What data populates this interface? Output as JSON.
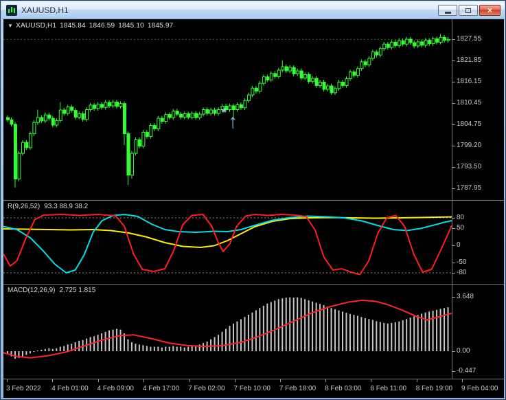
{
  "window": {
    "title": "XAUUSD,H1",
    "controls": {
      "minimize": "minimize",
      "restore": "restore",
      "close_glyph": "×"
    }
  },
  "chart": {
    "info": {
      "marker": "▼",
      "symbol": "XAUUSD,H1",
      "open": "1845.84",
      "high": "1846.59",
      "low": "1845.10",
      "close": "1845.97"
    },
    "price_axis_labels": [
      "1827.55",
      "1821.85",
      "1816.15",
      "1810.45",
      "1804.75",
      "1799.20",
      "1793.50",
      "1787.95"
    ],
    "time_axis_labels": [
      "3 Feb 2022",
      "4 Feb 01:00",
      "4 Feb 09:00",
      "4 Feb 17:00",
      "7 Feb 02:00",
      "7 Feb 10:00",
      "7 Feb 18:00",
      "8 Feb 03:00",
      "8 Feb 11:00",
      "8 Feb 19:00",
      "9 Feb 04:00"
    ],
    "colors": {
      "bull_fill": "#000000",
      "bear_fill": "#33ff33",
      "candle_outline": "#33ff33",
      "last_price_line": "#2f6e2f",
      "rci_short": "#ff1f1f",
      "rci_mid": "#00dde8",
      "rci_long": "#ffee00",
      "macd_hist": "#c8c8c8",
      "macd_signal": "#ff2424",
      "annotation": "#7fabd8"
    }
  },
  "indicators": [
    {
      "name": "R(9,26,52)",
      "values": "93.3 88.9 38.2",
      "scale_labels": [
        "80",
        "50",
        "0",
        "-50",
        "-80"
      ],
      "scale_values": [
        80,
        50,
        0,
        -50,
        -80
      ]
    },
    {
      "name": "MACD(12,26,9)",
      "values": "2.725 1.815",
      "scale_labels": [
        "3.648",
        "0.00",
        "-0.447"
      ],
      "scale_values": [
        3.648,
        0,
        -0.447
      ]
    }
  ],
  "chart_data": [
    {
      "type": "candlestick",
      "title": "XAUUSD,H1",
      "timeframe": "H1",
      "price_range_visible": [
        1784.9,
        1832.9
      ],
      "last_price": 1827.55,
      "first_open": 1806.8,
      "default_wick": 0.6,
      "closes": [
        1806.2,
        1805.0,
        1790.5,
        1797.3,
        1800.2,
        1798.8,
        1802.5,
        1805.5,
        1806.8,
        1805.9,
        1807.5,
        1806.6,
        1804.8,
        1806.0,
        1808.8,
        1807.9,
        1809.6,
        1808.7,
        1806.9,
        1807.8,
        1806.3,
        1808.9,
        1810.1,
        1809.2,
        1810.3,
        1809.5,
        1810.8,
        1809.9,
        1810.9,
        1809.8,
        1810.5,
        1802.5,
        1791.5,
        1797.3,
        1800.9,
        1799.2,
        1802.9,
        1801.8,
        1804.7,
        1803.8,
        1806.6,
        1805.8,
        1807.6,
        1806.8,
        1808.5,
        1807.7,
        1806.9,
        1807.8,
        1806.9,
        1807.9,
        1806.8,
        1807.7,
        1808.9,
        1807.9,
        1808.8,
        1807.9,
        1808.9,
        1809.8,
        1808.9,
        1809.9,
        1808.9,
        1810.2,
        1809.4,
        1811.3,
        1812.8,
        1814.6,
        1813.8,
        1815.9,
        1817.6,
        1816.8,
        1818.5,
        1817.7,
        1819.4,
        1820.3,
        1819.2,
        1820.1,
        1818.4,
        1819.2,
        1817.3,
        1818.2,
        1816.4,
        1817.2,
        1815.3,
        1816.2,
        1814.3,
        1815.2,
        1813.4,
        1814.5,
        1816.2,
        1815.3,
        1817.1,
        1818.9,
        1818.0,
        1819.8,
        1821.6,
        1820.8,
        1822.5,
        1824.2,
        1823.4,
        1825.1,
        1826.3,
        1825.4,
        1826.8,
        1825.9,
        1827.2,
        1826.3,
        1827.6,
        1826.7,
        1825.8,
        1826.9,
        1826.0,
        1827.3,
        1826.4,
        1827.7,
        1826.8,
        1828.1,
        1827.3,
        1827.55
      ],
      "wick_overrides": {
        "2": {
          "low": 1788.2
        },
        "3": {
          "low": 1789.8
        },
        "8": {
          "high": 1808.9
        },
        "14": {
          "high": 1810.9
        },
        "31": {
          "low": 1799.5
        },
        "32": {
          "low": 1788.9
        },
        "33": {
          "low": 1790.6
        },
        "60": {
          "low": 1806.2
        },
        "73": {
          "high": 1822.0
        },
        "115": {
          "high": 1829.0
        }
      }
    },
    {
      "type": "line",
      "title": "R(9,26,52)",
      "current_values": "93.3 88.9 38.2",
      "ylim": [
        -100,
        100
      ],
      "yticks": [
        80,
        50,
        0,
        -50,
        -80
      ],
      "levels": [
        80,
        -80
      ],
      "series": [
        {
          "name": "RCI-9",
          "color": "#ff1f1f",
          "points": [
            [
              0,
              -25
            ],
            [
              0.015,
              -60
            ],
            [
              0.03,
              -45
            ],
            [
              0.05,
              20
            ],
            [
              0.07,
              75
            ],
            [
              0.09,
              88
            ],
            [
              0.13,
              90
            ],
            [
              0.17,
              87
            ],
            [
              0.21,
              90
            ],
            [
              0.25,
              86
            ],
            [
              0.27,
              55
            ],
            [
              0.29,
              -25
            ],
            [
              0.31,
              -70
            ],
            [
              0.335,
              -76
            ],
            [
              0.36,
              -68
            ],
            [
              0.38,
              -15
            ],
            [
              0.4,
              60
            ],
            [
              0.42,
              87
            ],
            [
              0.445,
              90
            ],
            [
              0.465,
              55
            ],
            [
              0.478,
              12
            ],
            [
              0.49,
              -18
            ],
            [
              0.505,
              5
            ],
            [
              0.52,
              55
            ],
            [
              0.54,
              85
            ],
            [
              0.56,
              90
            ],
            [
              0.59,
              87
            ],
            [
              0.62,
              90
            ],
            [
              0.65,
              88
            ],
            [
              0.675,
              84
            ],
            [
              0.695,
              45
            ],
            [
              0.715,
              -35
            ],
            [
              0.735,
              -72
            ],
            [
              0.755,
              -68
            ],
            [
              0.775,
              -78
            ],
            [
              0.795,
              -85
            ],
            [
              0.815,
              -45
            ],
            [
              0.835,
              35
            ],
            [
              0.855,
              80
            ],
            [
              0.875,
              87
            ],
            [
              0.895,
              55
            ],
            [
              0.915,
              -25
            ],
            [
              0.935,
              -78
            ],
            [
              0.955,
              -70
            ],
            [
              0.975,
              -15
            ],
            [
              1,
              58
            ]
          ]
        },
        {
          "name": "RCI-26",
          "color": "#00dde8",
          "points": [
            [
              0,
              55
            ],
            [
              0.03,
              46
            ],
            [
              0.06,
              22
            ],
            [
              0.09,
              -18
            ],
            [
              0.115,
              -55
            ],
            [
              0.14,
              -80
            ],
            [
              0.16,
              -72
            ],
            [
              0.18,
              -28
            ],
            [
              0.2,
              38
            ],
            [
              0.22,
              72
            ],
            [
              0.245,
              87
            ],
            [
              0.27,
              90
            ],
            [
              0.3,
              84
            ],
            [
              0.33,
              62
            ],
            [
              0.36,
              46
            ],
            [
              0.39,
              40
            ],
            [
              0.43,
              38
            ],
            [
              0.47,
              41
            ],
            [
              0.5,
              40
            ],
            [
              0.53,
              46
            ],
            [
              0.56,
              58
            ],
            [
              0.6,
              73
            ],
            [
              0.64,
              81
            ],
            [
              0.68,
              85
            ],
            [
              0.72,
              83
            ],
            [
              0.76,
              80
            ],
            [
              0.8,
              71
            ],
            [
              0.84,
              56
            ],
            [
              0.87,
              46
            ],
            [
              0.9,
              43
            ],
            [
              0.93,
              49
            ],
            [
              0.96,
              59
            ],
            [
              0.98,
              66
            ],
            [
              1,
              72
            ]
          ]
        },
        {
          "name": "RCI-52",
          "color": "#ffee00",
          "points": [
            [
              0,
              48
            ],
            [
              0.05,
              47
            ],
            [
              0.1,
              46
            ],
            [
              0.15,
              45
            ],
            [
              0.2,
              46
            ],
            [
              0.24,
              43
            ],
            [
              0.28,
              36
            ],
            [
              0.32,
              24
            ],
            [
              0.36,
              8
            ],
            [
              0.4,
              -3
            ],
            [
              0.44,
              -6
            ],
            [
              0.47,
              -1
            ],
            [
              0.5,
              14
            ],
            [
              0.53,
              34
            ],
            [
              0.56,
              54
            ],
            [
              0.6,
              70
            ],
            [
              0.64,
              78
            ],
            [
              0.68,
              80
            ],
            [
              0.73,
              81
            ],
            [
              0.78,
              80
            ],
            [
              0.83,
              79
            ],
            [
              0.88,
              80
            ],
            [
              0.93,
              81
            ],
            [
              1,
              83
            ]
          ]
        }
      ]
    },
    {
      "type": "macd",
      "title": "MACD(12,26,9)",
      "current_values": "2.725 1.815",
      "yticks": [
        3.648,
        0,
        -0.447
      ],
      "histogram": [
        -0.2,
        -0.35,
        -0.5,
        -0.45,
        -0.35,
        -0.25,
        -0.15,
        -0.05,
        0.05,
        0.1,
        0.15,
        0.2,
        0.15,
        0.2,
        0.3,
        0.35,
        0.45,
        0.5,
        0.6,
        0.7,
        0.75,
        0.85,
        0.95,
        1.0,
        1.1,
        1.2,
        1.3,
        1.4,
        1.45,
        1.5,
        1.45,
        1.2,
        0.8,
        0.6,
        0.5,
        0.45,
        0.4,
        0.35,
        0.3,
        0.3,
        0.3,
        0.25,
        0.3,
        0.3,
        0.35,
        0.3,
        0.3,
        0.25,
        0.3,
        0.35,
        0.4,
        0.45,
        0.55,
        0.65,
        0.8,
        0.95,
        1.1,
        1.3,
        1.5,
        1.7,
        1.85,
        2.0,
        2.15,
        2.3,
        2.45,
        2.6,
        2.75,
        2.9,
        3.05,
        3.2,
        3.3,
        3.4,
        3.5,
        3.55,
        3.6,
        3.62,
        3.6,
        3.62,
        3.58,
        3.5,
        3.42,
        3.34,
        3.26,
        3.18,
        3.1,
        3.0,
        2.9,
        2.82,
        2.74,
        2.66,
        2.58,
        2.5,
        2.44,
        2.38,
        2.3,
        2.22,
        2.16,
        2.1,
        2.02,
        1.96,
        1.9,
        1.86,
        1.9,
        1.95,
        2.0,
        2.08,
        2.16,
        2.25,
        2.34,
        2.43,
        2.52,
        2.6,
        2.66,
        2.72,
        2.78,
        2.84,
        2.9,
        2.95
      ],
      "signal_points": [
        [
          0,
          -0.1
        ],
        [
          0.03,
          -0.35
        ],
        [
          0.06,
          -0.45
        ],
        [
          0.1,
          -0.3
        ],
        [
          0.14,
          -0.05
        ],
        [
          0.18,
          0.35
        ],
        [
          0.22,
          0.75
        ],
        [
          0.26,
          1.05
        ],
        [
          0.29,
          1.1
        ],
        [
          0.33,
          0.85
        ],
        [
          0.37,
          0.55
        ],
        [
          0.41,
          0.38
        ],
        [
          0.45,
          0.32
        ],
        [
          0.49,
          0.38
        ],
        [
          0.53,
          0.6
        ],
        [
          0.57,
          1.0
        ],
        [
          0.61,
          1.5
        ],
        [
          0.65,
          2.05
        ],
        [
          0.69,
          2.6
        ],
        [
          0.73,
          3.0
        ],
        [
          0.77,
          3.3
        ],
        [
          0.8,
          3.42
        ],
        [
          0.83,
          3.35
        ],
        [
          0.86,
          3.1
        ],
        [
          0.89,
          2.75
        ],
        [
          0.92,
          2.35
        ],
        [
          0.945,
          2.1
        ],
        [
          0.97,
          2.3
        ],
        [
          1,
          2.55
        ]
      ]
    }
  ],
  "annotation": {
    "star": "*",
    "arrow": "↑"
  }
}
